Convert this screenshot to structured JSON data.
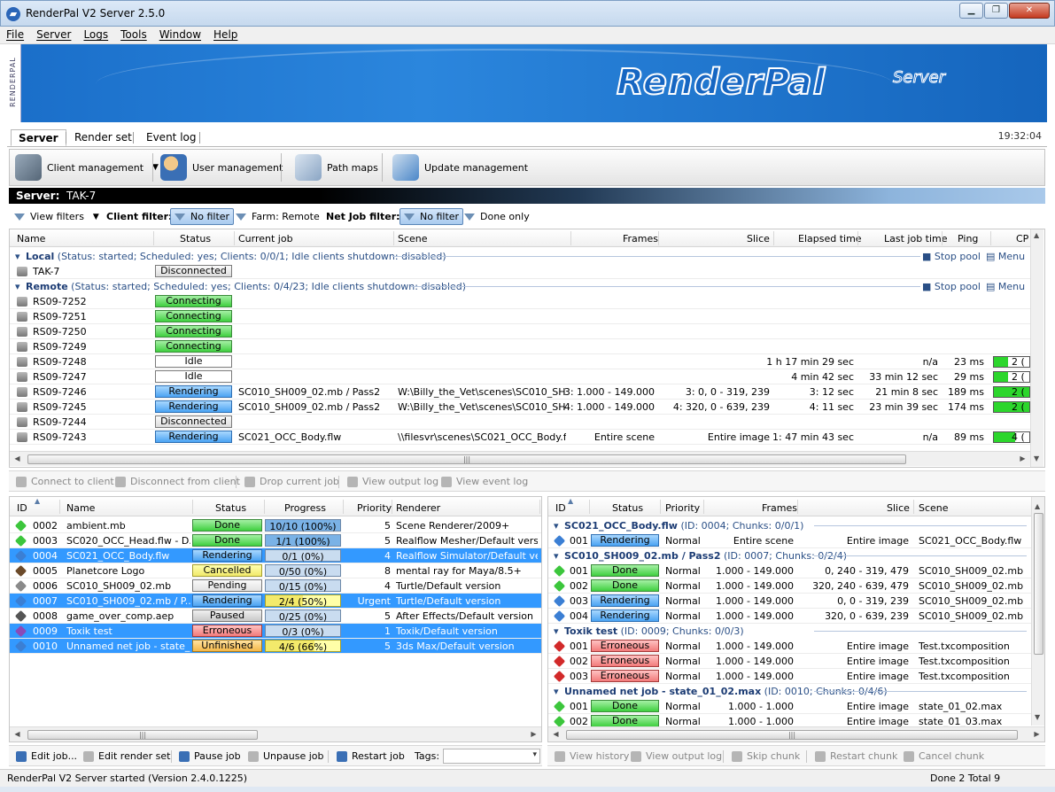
{
  "window": {
    "title": "RenderPal V2 Server 2.5.0",
    "icon": "renderpal-app-icon"
  },
  "menu": [
    "File",
    "Server",
    "Logs",
    "Tools",
    "Window",
    "Help"
  ],
  "banner": {
    "side_label": "RENDERPAL",
    "logo": "RenderPal",
    "logo_sub": "Server"
  },
  "tabs": [
    "Server",
    "Render set",
    "Event log"
  ],
  "clock": "19:32:04",
  "toolbar": {
    "client_management": "Client management",
    "user_management": "User management",
    "path_maps": "Path maps",
    "update_management": "Update management"
  },
  "server_bar": {
    "label": "Server:",
    "name": "TAK-7"
  },
  "filters": {
    "view_filters": "View filters",
    "client_filter": "Client filter:",
    "no_filter_1": "No filter",
    "farm_remote": "Farm: Remote",
    "net_job_filter": "Net Job filter:",
    "no_filter_2": "No filter",
    "done_only": "Done only"
  },
  "clients": {
    "columns": [
      "Name",
      "Status",
      "Current job",
      "Scene",
      "Frames",
      "Slice",
      "Elapsed time",
      "Last job time",
      "Ping",
      "CP"
    ],
    "groups": {
      "local": {
        "name": "Local",
        "info": "(Status: started; Scheduled: yes; Clients: 0/0/1; Idle clients shutdown: disabled)",
        "stop": "Stop pool",
        "menu": "Menu"
      },
      "remote": {
        "name": "Remote",
        "info": "(Status: started; Scheduled: yes; Clients: 0/4/23; Idle clients shutdown: disabled)",
        "stop": "Stop pool",
        "menu": "Menu"
      }
    },
    "local_rows": [
      {
        "name": "TAK-7",
        "status": "Disconnected"
      }
    ],
    "remote_rows": [
      {
        "name": "RS09-7252",
        "status": "Connecting"
      },
      {
        "name": "RS09-7251",
        "status": "Connecting"
      },
      {
        "name": "RS09-7250",
        "status": "Connecting"
      },
      {
        "name": "RS09-7249",
        "status": "Connecting"
      },
      {
        "name": "RS09-7248",
        "status": "Idle",
        "elapsed": "1 h 17 min 29 sec",
        "last": "n/a",
        "ping": "23 ms",
        "cpu": "2 (",
        "cpu_level": 0.4
      },
      {
        "name": "RS09-7247",
        "status": "Idle",
        "elapsed": "4 min 42 sec",
        "last": "33 min 12 sec",
        "ping": "29 ms",
        "cpu": "2 (",
        "cpu_level": 0.4
      },
      {
        "name": "RS09-7246",
        "status": "Rendering",
        "job": "SC010_SH009_02.mb / Pass2",
        "scene": "W:\\Billy_the_Vet\\scenes\\SC010_SH...",
        "frames": "3: 1.000 - 149.000",
        "slice": "3: 0, 0 - 319, 239",
        "elapsed": "3: 12 sec",
        "last": "21 min 8 sec",
        "ping": "189 ms",
        "cpu": "2 (",
        "cpu_level": 1.0
      },
      {
        "name": "RS09-7245",
        "status": "Rendering",
        "job": "SC010_SH009_02.mb / Pass2",
        "scene": "W:\\Billy_the_Vet\\scenes\\SC010_SH...",
        "frames": "4: 1.000 - 149.000",
        "slice": "4: 320, 0 - 639, 239",
        "elapsed": "4: 11 sec",
        "last": "23 min 39 sec",
        "ping": "174 ms",
        "cpu": "2 (",
        "cpu_level": 1.0
      },
      {
        "name": "RS09-7244",
        "status": "Disconnected"
      },
      {
        "name": "RS09-7243",
        "status": "Rendering",
        "job": "SC021_OCC_Body.flw",
        "scene": "\\\\filesvr\\scenes\\SC021_OCC_Body.f...",
        "frames": "Entire scene",
        "slice": "Entire image",
        "elapsed": "1: 47 min 43 sec",
        "last": "n/a",
        "ping": "89 ms",
        "cpu": "4 (",
        "cpu_level": 0.6
      }
    ]
  },
  "client_actions": [
    "Connect to client",
    "Disconnect from client",
    "Drop current job",
    "View output log",
    "View event log"
  ],
  "jobs": {
    "columns": [
      "ID",
      "Name",
      "Status",
      "Progress",
      "Priority",
      "Renderer"
    ],
    "rows": [
      {
        "id": "0002",
        "name": "ambient.mb",
        "status": "Done",
        "progress": "10/10 (100%)",
        "pct": 1.0,
        "priority": "5",
        "renderer": "Scene Renderer/2009+",
        "color": "#3cc63c"
      },
      {
        "id": "0003",
        "name": "SC020_OCC_Head.flw - D...",
        "status": "Done",
        "progress": "1/1 (100%)",
        "pct": 1.0,
        "priority": "5",
        "renderer": "Realflow Mesher/Default vers...",
        "color": "#3cc63c"
      },
      {
        "id": "0004",
        "name": "SC021_OCC_Body.flw",
        "status": "Rendering",
        "progress": "0/1 (0%)",
        "pct": 0.0,
        "priority": "4",
        "renderer": "Realflow Simulator/Default ve...",
        "color": "#3b7fd4",
        "selected": true
      },
      {
        "id": "0005",
        "name": "Planetcore Logo",
        "status": "Cancelled",
        "progress": "0/50 (0%)",
        "pct": 0.0,
        "priority": "8",
        "renderer": "mental ray for Maya/8.5+",
        "color": "#6b4a2a"
      },
      {
        "id": "0006",
        "name": "SC010_SH009_02.mb",
        "status": "Pending",
        "progress": "0/15 (0%)",
        "pct": 0.0,
        "priority": "4",
        "renderer": "Turtle/Default version",
        "color": "#8a8a8a"
      },
      {
        "id": "0007",
        "name": "SC010_SH009_02.mb / P...",
        "status": "Rendering",
        "progress": "2/4 (50%)",
        "pct": 0.5,
        "priority": "Urgent",
        "renderer": "Turtle/Default version",
        "color": "#3b7fd4",
        "selected": true
      },
      {
        "id": "0008",
        "name": "game_over_comp.aep",
        "status": "Paused",
        "progress": "0/25 (0%)",
        "pct": 0.0,
        "priority": "5",
        "renderer": "After Effects/Default version",
        "color": "#555555"
      },
      {
        "id": "0009",
        "name": "Toxik test",
        "status": "Erroneous",
        "progress": "0/3 (0%)",
        "pct": 0.0,
        "priority": "1",
        "renderer": "Toxik/Default version",
        "color": "#8a4ab8",
        "selected": true
      },
      {
        "id": "0010",
        "name": "Unnamed net job - state_0...",
        "status": "Unfinished",
        "progress": "4/6 (66%)",
        "pct": 0.66,
        "priority": "5",
        "renderer": "3ds Max/Default version",
        "color": "#3b7fd4",
        "selected": true
      }
    ]
  },
  "job_actions": {
    "edit_job": "Edit job...",
    "edit_render_set": "Edit render set",
    "pause_job": "Pause job",
    "unpause_job": "Unpause job",
    "restart_job": "Restart job",
    "tags": "Tags:"
  },
  "chunks": {
    "columns": [
      "ID",
      "Status",
      "Priority",
      "Frames",
      "Slice",
      "Scene"
    ],
    "groups": [
      {
        "title": "SC021_OCC_Body.flw",
        "info": "(ID: 0004; Chunks: 0/0/1)",
        "rows": [
          {
            "id": "001",
            "status": "Rendering",
            "priority": "Normal",
            "frames": "Entire scene",
            "slice": "Entire image",
            "scene": "SC021_OCC_Body.flw",
            "color": "#3b7fd4"
          }
        ]
      },
      {
        "title": "SC010_SH009_02.mb / Pass2",
        "info": "(ID: 0007; Chunks: 0/2/4)",
        "rows": [
          {
            "id": "001",
            "status": "Done",
            "priority": "Normal",
            "frames": "1.000 - 149.000",
            "slice": "0, 240 - 319, 479",
            "scene": "SC010_SH009_02.mb",
            "color": "#3cc63c"
          },
          {
            "id": "002",
            "status": "Done",
            "priority": "Normal",
            "frames": "1.000 - 149.000",
            "slice": "320, 240 - 639, 479",
            "scene": "SC010_SH009_02.mb",
            "color": "#3cc63c"
          },
          {
            "id": "003",
            "status": "Rendering",
            "priority": "Normal",
            "frames": "1.000 - 149.000",
            "slice": "0, 0 - 319, 239",
            "scene": "SC010_SH009_02.mb",
            "color": "#3b7fd4"
          },
          {
            "id": "004",
            "status": "Rendering",
            "priority": "Normal",
            "frames": "1.000 - 149.000",
            "slice": "320, 0 - 639, 239",
            "scene": "SC010_SH009_02.mb",
            "color": "#3b7fd4"
          }
        ]
      },
      {
        "title": "Toxik test",
        "info": "(ID: 0009; Chunks: 0/0/3)",
        "rows": [
          {
            "id": "001",
            "status": "Erroneous",
            "priority": "Normal",
            "frames": "1.000 - 149.000",
            "slice": "Entire image",
            "scene": "Test.txcomposition",
            "color": "#d22a2a"
          },
          {
            "id": "002",
            "status": "Erroneous",
            "priority": "Normal",
            "frames": "1.000 - 149.000",
            "slice": "Entire image",
            "scene": "Test.txcomposition",
            "color": "#d22a2a"
          },
          {
            "id": "003",
            "status": "Erroneous",
            "priority": "Normal",
            "frames": "1.000 - 149.000",
            "slice": "Entire image",
            "scene": "Test.txcomposition",
            "color": "#d22a2a"
          }
        ]
      },
      {
        "title": "Unnamed net job - state_01_02.max",
        "info": "(ID: 0010; Chunks: 0/4/6)",
        "rows": [
          {
            "id": "001",
            "status": "Done",
            "priority": "Normal",
            "frames": "1.000 - 1.000",
            "slice": "Entire image",
            "scene": "state_01_02.max",
            "color": "#3cc63c"
          },
          {
            "id": "002",
            "status": "Done",
            "priority": "Normal",
            "frames": "1.000 - 1.000",
            "slice": "Entire image",
            "scene": "state_01_03.max",
            "color": "#3cc63c"
          }
        ]
      }
    ]
  },
  "chunk_actions": [
    "View history",
    "View output log",
    "Skip chunk",
    "Restart chunk",
    "Cancel chunk"
  ],
  "status_bar": {
    "message": "RenderPal V2 Server started (Version 2.4.0.1225)",
    "counts": "Done 2 Total 9"
  }
}
